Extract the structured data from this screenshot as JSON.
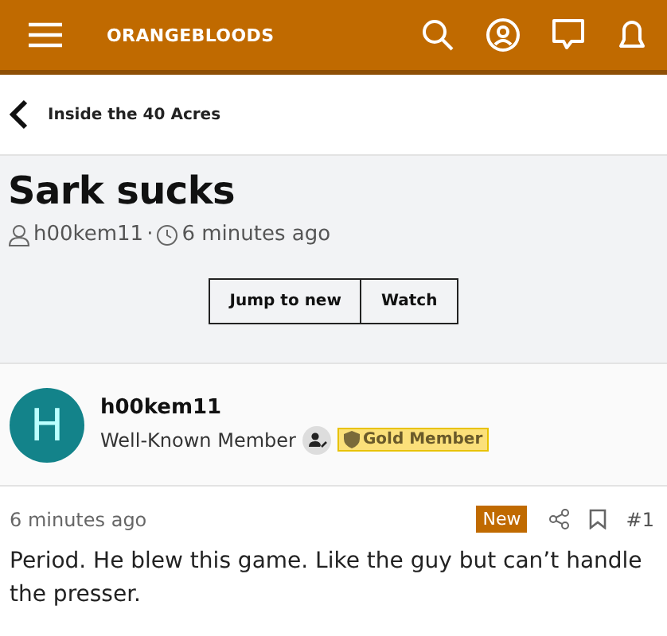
{
  "header": {
    "site_name": "ORANGEBLOODS"
  },
  "breadcrumb": {
    "label": "Inside the 40 Acres"
  },
  "thread": {
    "title": "Sark sucks",
    "author": "h00kem11",
    "separator": "·",
    "time": "6 minutes ago"
  },
  "buttons": [
    "Jump to new",
    "Watch"
  ],
  "post": {
    "avatar_letter": "H",
    "username": "h00kem11",
    "user_title": "Well-Known Member",
    "badge": "Gold Member",
    "time": "6 minutes ago",
    "new_label": "New",
    "number": "#1",
    "body": "Period. He blew this game. Like the guy but can’t handle the presser."
  }
}
